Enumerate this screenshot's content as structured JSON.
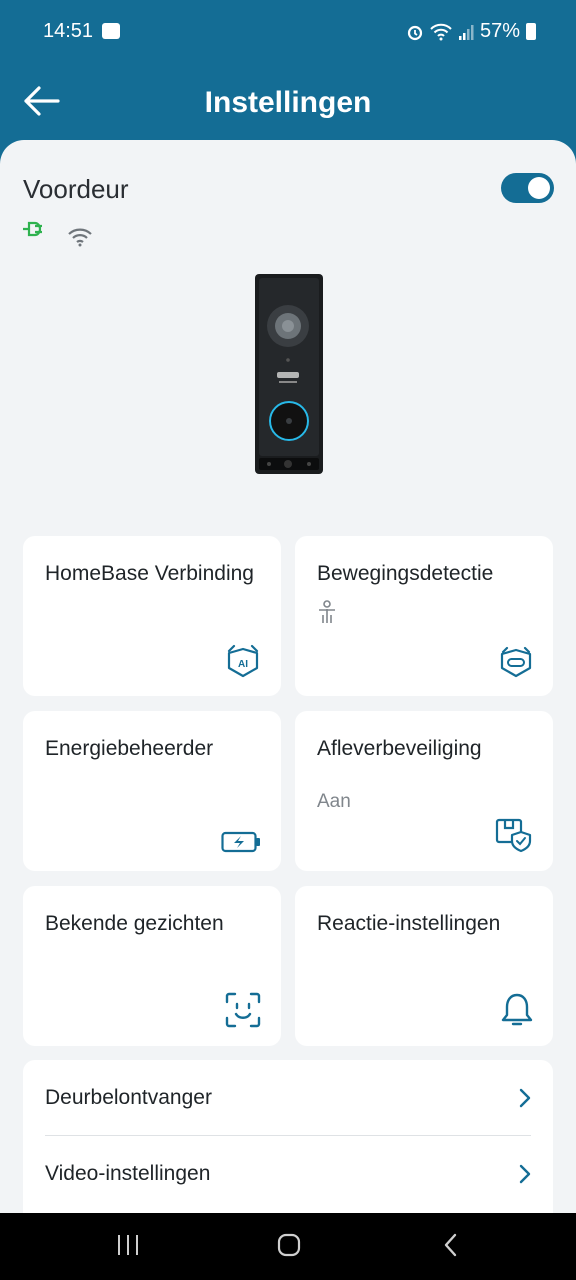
{
  "status_bar": {
    "time": "14:51",
    "battery": "57%"
  },
  "header": {
    "title": "Instellingen"
  },
  "device": {
    "name": "Voordeur",
    "enabled": true
  },
  "cards": [
    {
      "title": "HomeBase Verbinding",
      "subtitle": "",
      "icon": "homebase-ai-icon"
    },
    {
      "title": "Bewegingsdetectie",
      "subtitle": "",
      "icon": "motion-detection-icon"
    },
    {
      "title": "Energiebeheerder",
      "subtitle": "",
      "icon": "battery-charging-icon"
    },
    {
      "title": "Afleverbeveiliging",
      "subtitle": "Aan",
      "icon": "package-shield-icon"
    },
    {
      "title": "Bekende gezichten",
      "subtitle": "",
      "icon": "face-scan-icon"
    },
    {
      "title": "Reactie-instellingen",
      "subtitle": "",
      "icon": "bell-icon"
    }
  ],
  "list": [
    {
      "label": "Deurbelontvanger"
    },
    {
      "label": "Video-instellingen"
    }
  ],
  "colors": {
    "accent": "#146d95",
    "background": "#f2f4f6",
    "plug_green": "#2fb24f"
  }
}
